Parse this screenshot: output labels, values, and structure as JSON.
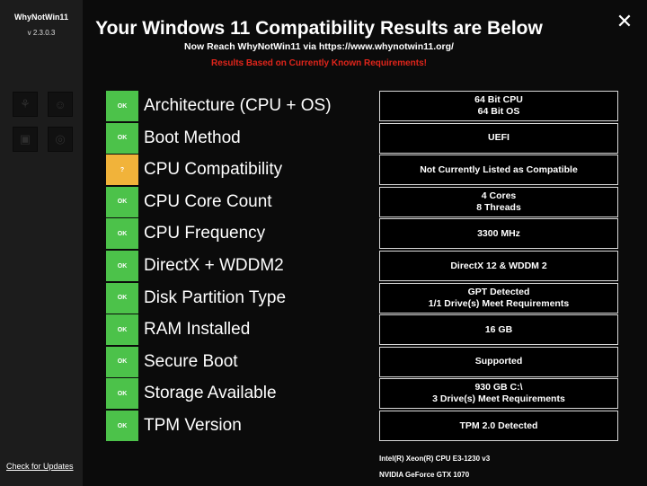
{
  "app": {
    "name": "WhyNotWin11",
    "version": "v 2.3.0.3"
  },
  "sidebar": {
    "buttons": [
      {
        "name": "sidebar-github-button",
        "glyph": "⚘"
      },
      {
        "name": "sidebar-donate-button",
        "glyph": "☺"
      },
      {
        "name": "sidebar-discord-button",
        "glyph": "▣"
      },
      {
        "name": "sidebar-web-button",
        "glyph": "◎"
      }
    ],
    "check_updates": "Check for Updates"
  },
  "header": {
    "title": "Your Windows 11 Compatibility Results are Below",
    "subtitle": "Now Reach WhyNotWin11 via https://www.whynotwin11.org/",
    "notice": "Results Based on Currently Known Requirements!",
    "close_glyph": "✕"
  },
  "checks": [
    {
      "status": "OK",
      "label": "Architecture (CPU + OS)",
      "result": [
        "64 Bit CPU",
        "64 Bit OS"
      ]
    },
    {
      "status": "OK",
      "label": "Boot Method",
      "result": [
        "UEFI"
      ]
    },
    {
      "status": "?",
      "label": "CPU Compatibility",
      "result": [
        "Not Currently Listed as Compatible"
      ]
    },
    {
      "status": "OK",
      "label": "CPU Core Count",
      "result": [
        "4 Cores",
        "8 Threads"
      ]
    },
    {
      "status": "OK",
      "label": "CPU Frequency",
      "result": [
        "3300 MHz"
      ]
    },
    {
      "status": "OK",
      "label": "DirectX + WDDM2",
      "result": [
        "DirectX 12 & WDDM 2"
      ]
    },
    {
      "status": "OK",
      "label": "Disk Partition Type",
      "result": [
        "GPT Detected",
        "1/1 Drive(s) Meet Requirements"
      ]
    },
    {
      "status": "OK",
      "label": "RAM Installed",
      "result": [
        "16 GB"
      ]
    },
    {
      "status": "OK",
      "label": "Secure Boot",
      "result": [
        "Supported"
      ]
    },
    {
      "status": "OK",
      "label": "Storage Available",
      "result": [
        "930 GB C:\\",
        "3 Drive(s) Meet Requirements"
      ]
    },
    {
      "status": "OK",
      "label": "TPM Version",
      "result": [
        "TPM 2.0 Detected"
      ]
    }
  ],
  "hardware": {
    "cpu": "Intel(R) Xeon(R) CPU E3-1230 v3",
    "gpu": "NVIDIA GeForce GTX 1070"
  },
  "colors": {
    "ok": "#4cc24a",
    "warning": "#f1b33a",
    "notice": "#e0251b",
    "background": "#0b0b0b",
    "sidebar": "#1c1c1c"
  }
}
